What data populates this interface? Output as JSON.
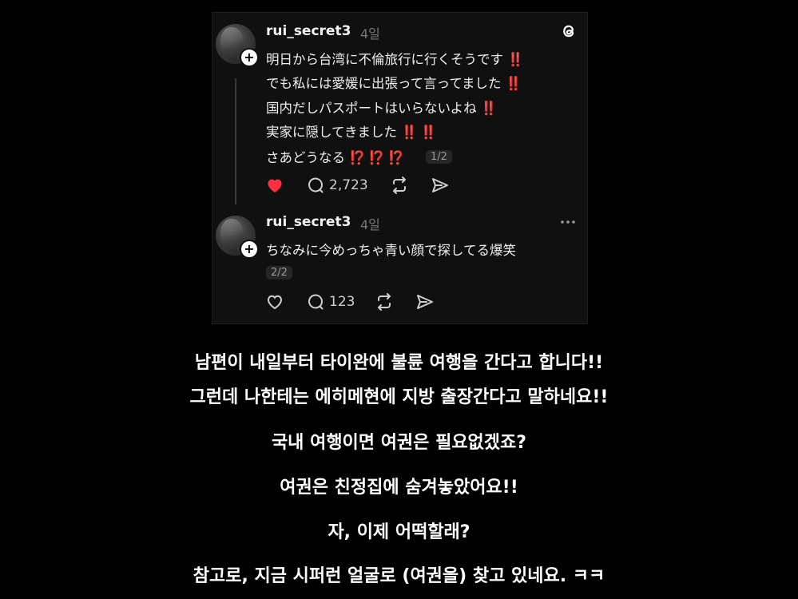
{
  "post1": {
    "username": "rui_secret3",
    "time": "4일",
    "lines": [
      {
        "text": "明日から台湾に不倫旅行に行くそうです",
        "mark": "‼️"
      },
      {
        "text": "でも私には愛媛に出張って言ってました",
        "mark": "‼️"
      },
      {
        "text": "国内だしパスポートはいらないよね",
        "mark": "‼️"
      },
      {
        "text": "実家に隠してきました",
        "mark": "‼️ ‼️"
      },
      {
        "text": "さあどうなる",
        "mark": "⁉️ ⁉️ ⁉️"
      }
    ],
    "page": "1/2",
    "replies": "2,723",
    "liked": true
  },
  "post2": {
    "username": "rui_secret3",
    "time": "4일",
    "text": "ちなみに今めっちゃ青い顔で探してる爆笑",
    "page": "2/2",
    "replies": "123",
    "liked": false
  },
  "captions": [
    "남편이 내일부터 타이완에 불륜 여행을 간다고 합니다!!",
    "그런데 나한테는 에히메현에 지방 출장간다고 말하네요!!",
    "국내 여행이면 여권은 필요없겠죠?",
    "여권은 친정집에 숨겨놓았어요!!",
    "자, 이제 어떡할래?",
    "참고로, 지금 시퍼런 얼굴로 (여권을) 찾고 있네요. ㅋㅋ"
  ],
  "colors": {
    "like": "#ff3040",
    "background": "#000000",
    "card": "#101010",
    "mark": "#e8242a"
  },
  "icons": [
    "threads-logo-icon",
    "plus-icon",
    "heart-icon",
    "comment-icon",
    "repost-icon",
    "share-icon",
    "more-icon"
  ]
}
